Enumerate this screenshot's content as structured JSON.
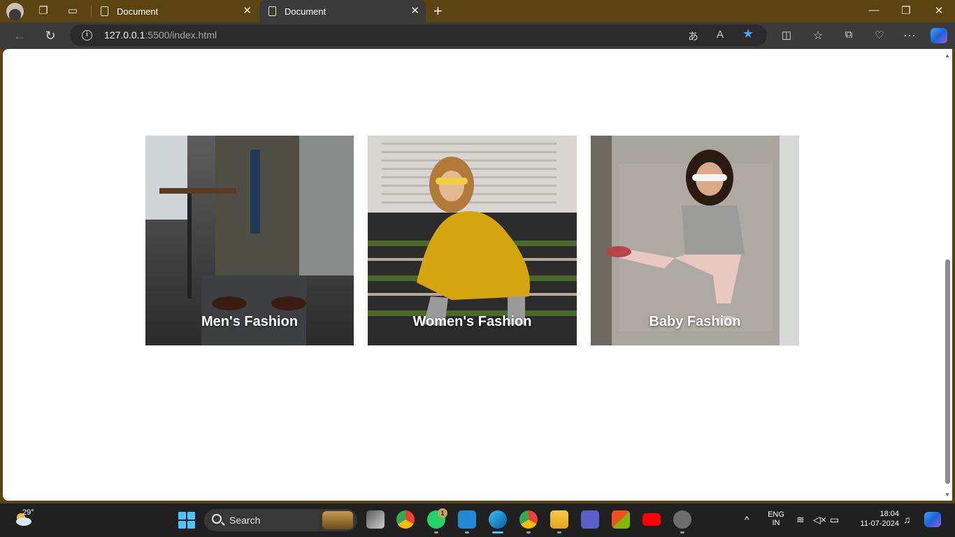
{
  "browser": {
    "tabs": [
      {
        "label": "Document",
        "active": false
      },
      {
        "label": "Document",
        "active": true
      }
    ],
    "url_host": "127.0.0.1",
    "url_rest": ":5500/index.html"
  },
  "page": {
    "cards": [
      {
        "caption": "Men's Fashion",
        "image": "man-in-suit-photo"
      },
      {
        "caption": "Women's Fashion",
        "image": "woman-in-yellow-dress-photo"
      },
      {
        "caption": "Baby Fashion",
        "image": "girl-in-sunglasses-photo"
      }
    ]
  },
  "taskbar": {
    "temperature": "29°",
    "search_label": "Search",
    "whatsapp_badge": "1",
    "lang_line1": "ENG",
    "lang_line2": "IN",
    "time": "18:04",
    "date": "11-07-2024"
  },
  "colors": {
    "titlebar": "#5b4412",
    "toolbar": "#3b3b3b",
    "taskbar": "#202020",
    "accent": "#4cc2ff"
  }
}
